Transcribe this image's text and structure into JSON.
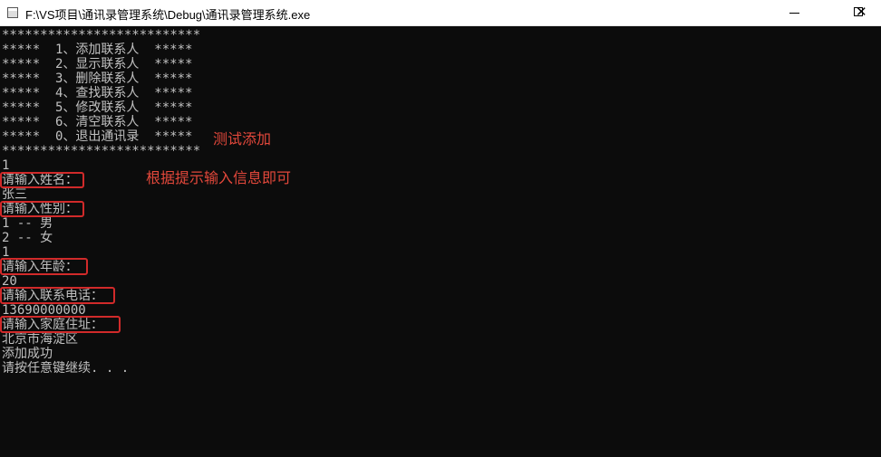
{
  "window": {
    "title": "F:\\VS项目\\通讯录管理系统\\Debug\\通讯录管理系统.exe",
    "icon": "console-app-icon",
    "controls": {
      "minimize": "minimize-icon",
      "maximize": "maximize-icon",
      "close": "close-icon"
    }
  },
  "console": {
    "lines": [
      "**************************",
      "*****  1、添加联系人  *****",
      "*****  2、显示联系人  *****",
      "*****  3、删除联系人  *****",
      "*****  4、查找联系人  *****",
      "*****  5、修改联系人  *****",
      "*****  6、清空联系人  *****",
      "*****  0、退出通讯录  *****",
      "**************************",
      "1",
      "请输入姓名：",
      "张三",
      "请输入性别：",
      "1 -- 男",
      "2 -- 女",
      "1",
      "请输入年龄：",
      "20",
      "请输入联系电话：",
      "13690000000",
      "请输入家庭住址：",
      "北京市海淀区",
      "添加成功",
      "请按任意键继续. . ."
    ]
  },
  "annotations": {
    "test_add": "测试添加",
    "hint": "根据提示输入信息即可"
  },
  "colors": {
    "console_bg": "#0c0c0c",
    "console_text": "#c0c0c0",
    "highlight": "#d12a2a",
    "annotation": "#e3483b"
  }
}
